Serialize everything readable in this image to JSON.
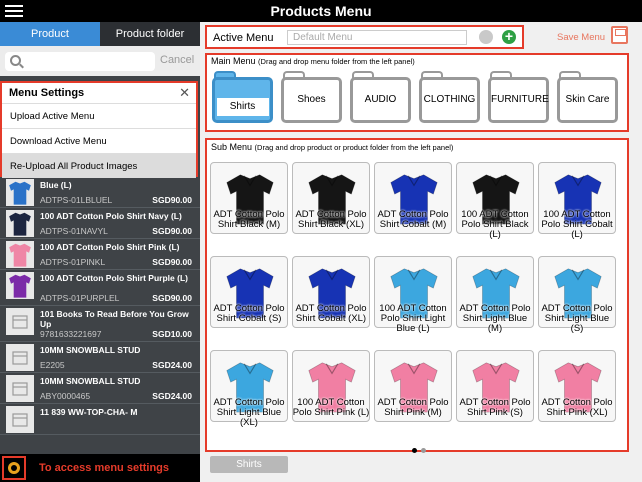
{
  "header": {
    "title": "Products Menu"
  },
  "left_panel": {
    "tabs": [
      {
        "label": "Product"
      },
      {
        "label": "Product folder"
      }
    ],
    "search": {
      "placeholder": "",
      "cancel_label": "Cancel"
    },
    "menu_settings": {
      "title": "Menu Settings",
      "items": [
        "Upload Active Menu",
        "Download Active Menu",
        "Re-Upload All Product Images"
      ]
    },
    "products": [
      {
        "name": "Blue (L)",
        "code": "ADTPS-01LBLUEL",
        "price": "SGD90.00",
        "color": "#2a72c8"
      },
      {
        "name": "100 ADT Cotton Polo Shirt Navy (L)",
        "code": "ADTPS-01NAVYL",
        "price": "SGD90.00",
        "color": "#1c2540"
      },
      {
        "name": "100 ADT Cotton Polo Shirt Pink (L)",
        "code": "ADTPS-01PINKL",
        "price": "SGD90.00",
        "color": "#ef86a6"
      },
      {
        "name": "100 ADT Cotton Polo Shirt Purple (L)",
        "code": "ADTPS-01PURPLEL",
        "price": "SGD90.00",
        "color": "#7b2aa8"
      },
      {
        "name": "101 Books To Read Before You Grow Up",
        "code": "9781633221697",
        "price": "SGD10.00",
        "color": ""
      },
      {
        "name": "10MM SNOWBALL STUD",
        "code": "E2205",
        "price": "SGD24.00",
        "color": ""
      },
      {
        "name": "10MM SNOWBALL STUD",
        "code": "ABY0000465",
        "price": "SGD24.00",
        "color": ""
      },
      {
        "name": "11 839 WW-TOP-CHA- M",
        "code": "",
        "price": "",
        "color": ""
      }
    ],
    "footer_label": "To access menu settings"
  },
  "active_menu": {
    "label": "Active Menu",
    "placeholder": "Default Menu",
    "save_label": "Save Menu"
  },
  "main_menu": {
    "title": "Main Menu",
    "hint": "(Drag and drop menu folder from the left panel)",
    "folders": [
      "Shirts",
      "Shoes",
      "AUDIO",
      "CLOTHING",
      "FURNITURE",
      "Skin Care"
    ],
    "selected": "Shirts"
  },
  "sub_menu": {
    "title": "Sub Menu",
    "hint": "(Drag and drop product or product folder from the left panel)",
    "items": [
      {
        "label": "ADT Cotton Polo Shirt Black (M)",
        "color": "#151515"
      },
      {
        "label": "ADT Cotton Polo Shirt Black (XL)",
        "color": "#151515"
      },
      {
        "label": "ADT Cotton Polo Shirt Cobalt (M)",
        "color": "#1733b4"
      },
      {
        "label": "100 ADT Cotton Polo Shirt Black (L)",
        "color": "#151515"
      },
      {
        "label": "100 ADT Cotton Polo Shirt Cobalt (L)",
        "color": "#1733b4"
      },
      {
        "label": "ADT Cotton Polo Shirt Cobalt (S)",
        "color": "#1733b4"
      },
      {
        "label": "ADT Cotton Polo Shirt Cobalt (XL)",
        "color": "#1733b4"
      },
      {
        "label": "100 ADT Cotton Polo Shirt Light Blue (L)",
        "color": "#3ca7df"
      },
      {
        "label": "ADT Cotton Polo Shirt Light Blue (M)",
        "color": "#3ca7df"
      },
      {
        "label": "ADT Cotton Polo Shirt Light Blue (S)",
        "color": "#3ca7df"
      },
      {
        "label": "ADT Cotton Polo Shirt Light Blue (XL)",
        "color": "#3ca7df"
      },
      {
        "label": "100 ADT Cotton Polo Shirt Pink (L)",
        "color": "#f17fa3"
      },
      {
        "label": "ADT Cotton Polo Shirt Pink (M)",
        "color": "#f17fa3"
      },
      {
        "label": "ADT Cotton Polo Shirt Pink (S)",
        "color": "#f17fa3"
      },
      {
        "label": "ADT Cotton Polo Shirt Pink (XL)",
        "color": "#f17fa3"
      }
    ]
  },
  "bottom_bar": {
    "current_folder": "Shirts"
  },
  "colors": {
    "highlight": "#e53b2a",
    "accent_blue": "#3a8bd6",
    "add_green": "#2ea044"
  }
}
